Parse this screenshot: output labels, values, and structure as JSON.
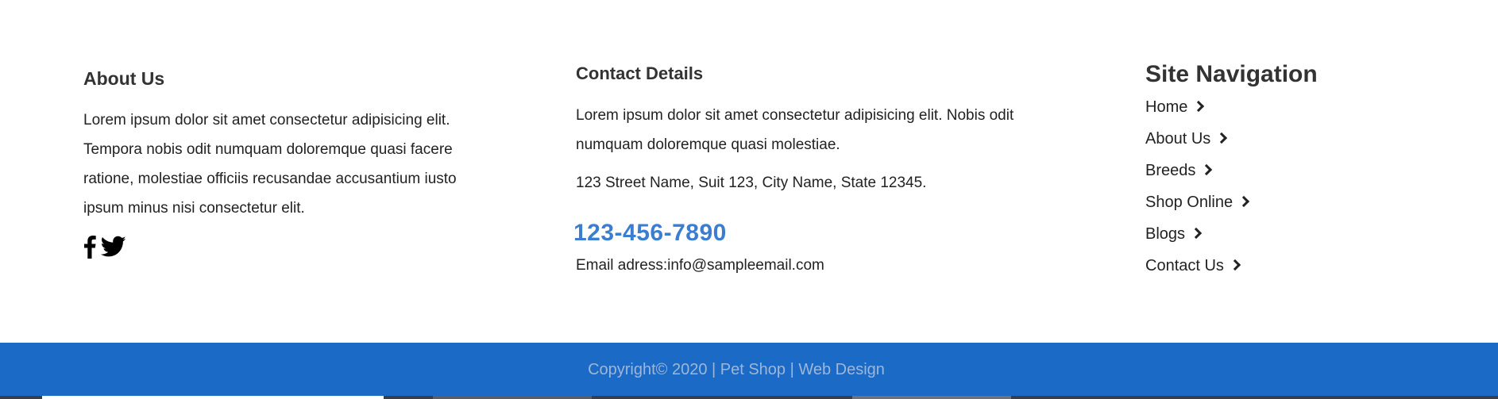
{
  "about": {
    "title": "About Us",
    "text": "Lorem ipsum dolor sit amet consectetur adipisicing elit. Tempora nobis odit numquam doloremque quasi facere ratione, molestiae officiis recusandae accusantium iusto ipsum minus nisi consectetur elit.",
    "social_icons": [
      "facebook-icon",
      "twitter-icon"
    ]
  },
  "contact": {
    "title": "Contact Details",
    "text": "Lorem ipsum dolor sit amet consectetur adipisicing elit. Nobis odit numquam doloremque quasi molestiae.",
    "address": "123 Street Name, Suit 123, City Name, State 12345.",
    "phone": "123-456-7890",
    "email": "Email adress:info@sampleemail.com"
  },
  "site_nav": {
    "title": "Site Navigation",
    "items": [
      {
        "label": "Home"
      },
      {
        "label": "About Us"
      },
      {
        "label": "Breeds"
      },
      {
        "label": "Shop Online"
      },
      {
        "label": "Blogs"
      },
      {
        "label": "Contact Us"
      }
    ]
  },
  "copyright": {
    "text": "Copyright© 2020 | Pet Shop | Web Design"
  },
  "colors": {
    "accent": "#3b7ed0",
    "copyright_bar": "#1b6ac6",
    "copyright_text": "#9fb6d6"
  }
}
